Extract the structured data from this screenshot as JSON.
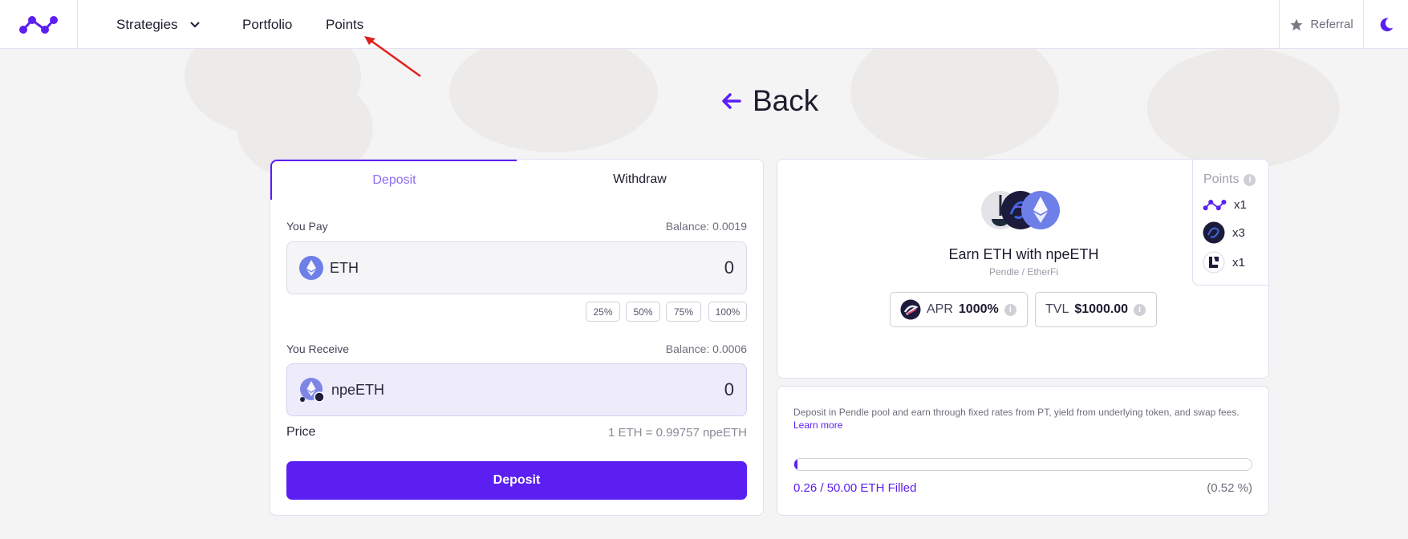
{
  "nav": {
    "logo": "logo-icon",
    "items": [
      {
        "label": "Strategies",
        "icon": "chevron-down-icon"
      },
      {
        "label": "Portfolio"
      },
      {
        "label": "Points"
      }
    ],
    "referral_label": "Referral",
    "referral_icon": "star-icon",
    "theme_icon": "moon-icon"
  },
  "back_label": "Back",
  "trade": {
    "tabs": [
      "Deposit",
      "Withdraw"
    ],
    "active_tab": "Deposit",
    "pay": {
      "label": "You Pay",
      "balance": "Balance: 0.0019",
      "token": "ETH",
      "amount": "0"
    },
    "percent_buttons": [
      "25%",
      "50%",
      "75%",
      "100%"
    ],
    "receive": {
      "label": "You Receive",
      "balance": "Balance: 0.0006",
      "token": "npeETH",
      "amount": "0"
    },
    "price_label": "Price",
    "price_value": "1 ETH = 0.99757 npeETH",
    "submit_label": "Deposit"
  },
  "strategy": {
    "title": "Earn ETH with npeETH",
    "subtitle": "Pendle / EtherFi",
    "apr_label": "APR",
    "apr_value": "1000%",
    "tvl_label": "TVL",
    "tvl_value": "$1000.00",
    "points_title": "Points",
    "points": [
      {
        "icon": "logo-icon",
        "multiplier": "x1"
      },
      {
        "icon": "etherfi-icon",
        "multiplier": "x3"
      },
      {
        "icon": "lido-icon",
        "multiplier": "x1"
      }
    ]
  },
  "info": {
    "description": "Deposit in Pendle pool and earn through fixed rates from PT, yield from underlying token, and swap fees.",
    "learn_more": "Learn more",
    "filled_text": "0.26 / 50.00 ETH Filled",
    "filled_percent": "(0.52 %)",
    "fill_fraction": 0.0052
  },
  "colors": {
    "accent": "#5b1ff2",
    "background": "#f5f4f4"
  }
}
